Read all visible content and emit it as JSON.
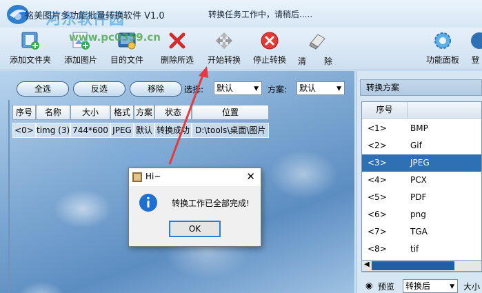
{
  "app": {
    "title": "铭美图片多功能批量转换软件 V1.0",
    "status": "转换任务工作中，请稍后.....",
    "watermark": "河东软件园",
    "watermark_url": "www.pc0359.cn"
  },
  "toolbar": {
    "add_folder": "添加文件夹",
    "add_image": "添加图片",
    "target_file": "目的文件",
    "delete_selected": "删除所选",
    "start_convert": "开始转换",
    "stop_convert": "停止转换",
    "clear": "清",
    "remove": "除",
    "function_panel": "功能面板",
    "login": "登"
  },
  "controls": {
    "select_all": "全选",
    "invert": "反选",
    "remove": "移除",
    "select_label": "选择:",
    "select_value": "默认",
    "scheme_label": "方案:",
    "scheme_value": "默认"
  },
  "table": {
    "headers": [
      "序号",
      "名称",
      "大小",
      "格式",
      "方案",
      "状态",
      "位置"
    ],
    "rows": [
      [
        "<0>",
        "timg (3)",
        "744*600",
        "JPEG",
        "默认",
        "转换成功",
        "D:\\tools\\桌面\\图片"
      ]
    ]
  },
  "scheme_panel": {
    "title": "转换方案",
    "header_no": "序号",
    "header_fmt": "",
    "items": [
      {
        "no": "<1>",
        "fmt": "BMP"
      },
      {
        "no": "<2>",
        "fmt": "Gif"
      },
      {
        "no": "<3>",
        "fmt": "JPEG"
      },
      {
        "no": "<4>",
        "fmt": "PCX"
      },
      {
        "no": "<5>",
        "fmt": "PDF"
      },
      {
        "no": "<6>",
        "fmt": "png"
      },
      {
        "no": "<7>",
        "fmt": "TGA"
      },
      {
        "no": "<8>",
        "fmt": "tif"
      }
    ],
    "selected_index": 2,
    "preview_label": "预览",
    "preview_value": "转换后",
    "size_label": "大小"
  },
  "dialog": {
    "title": "Hi~",
    "message": "转换工作已全部完成!",
    "ok": "OK"
  },
  "colors": {
    "selection": "#2f6fb3",
    "arrow": "#e23b3b",
    "info_icon": "#1e6fd1"
  }
}
